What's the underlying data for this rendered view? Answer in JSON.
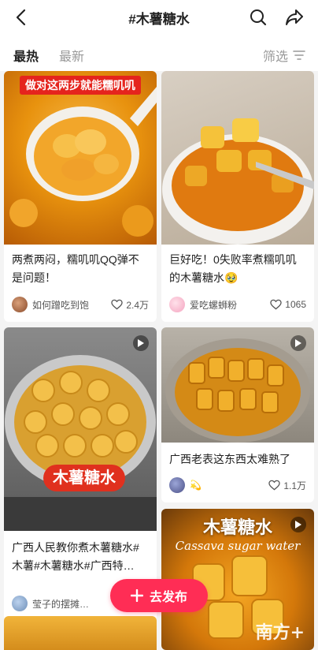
{
  "header": {
    "title": "#木薯糖水"
  },
  "tabs": {
    "hot": "最热",
    "latest": "最新",
    "filter": "筛选"
  },
  "cards": [
    {
      "overlay": "做对这两步就能糯叽叽",
      "title": "两煮两闷，糯叽叽QQ弹不是问题！",
      "author": "如何蹭吃到饱",
      "likes": "2.4万"
    },
    {
      "title": "巨好吃！0失败率煮糯叽叽的木薯糖水🥹",
      "author": "爱吃螺蛳粉",
      "likes": "1065"
    },
    {
      "overlay": "木薯糖水",
      "title": "广西人民教你煮木薯糖水#木薯#木薯糖水#广西特…",
      "author": "莹子的摆摊…",
      "likes": ""
    },
    {
      "title": "广西老表这东西太难熟了",
      "author": "💫",
      "likes": "1.1万"
    },
    {
      "overlay": "木薯糖水",
      "overlay_sub": "Cassava sugar water",
      "watermark": "南方+"
    }
  ],
  "fab": {
    "label": "去发布"
  },
  "colors": {
    "accent": "#ff2d55"
  }
}
